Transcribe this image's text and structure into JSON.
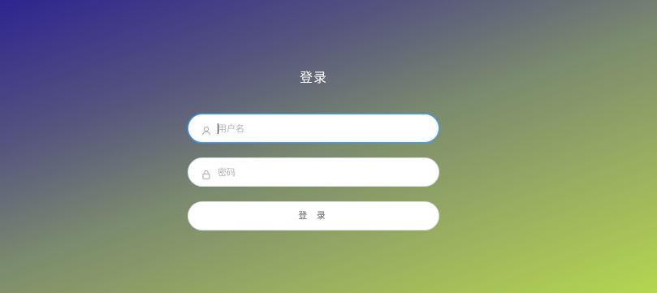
{
  "form": {
    "title": "登录",
    "username": {
      "placeholder": "用户名",
      "value": "",
      "icon": "user-icon"
    },
    "password": {
      "placeholder": "密码",
      "value": "",
      "icon": "lock-icon"
    },
    "submit_label": "登 录"
  },
  "colors": {
    "gradient_start": "#2e2490",
    "gradient_end": "#b4d650",
    "focus_border": "#409eff"
  }
}
